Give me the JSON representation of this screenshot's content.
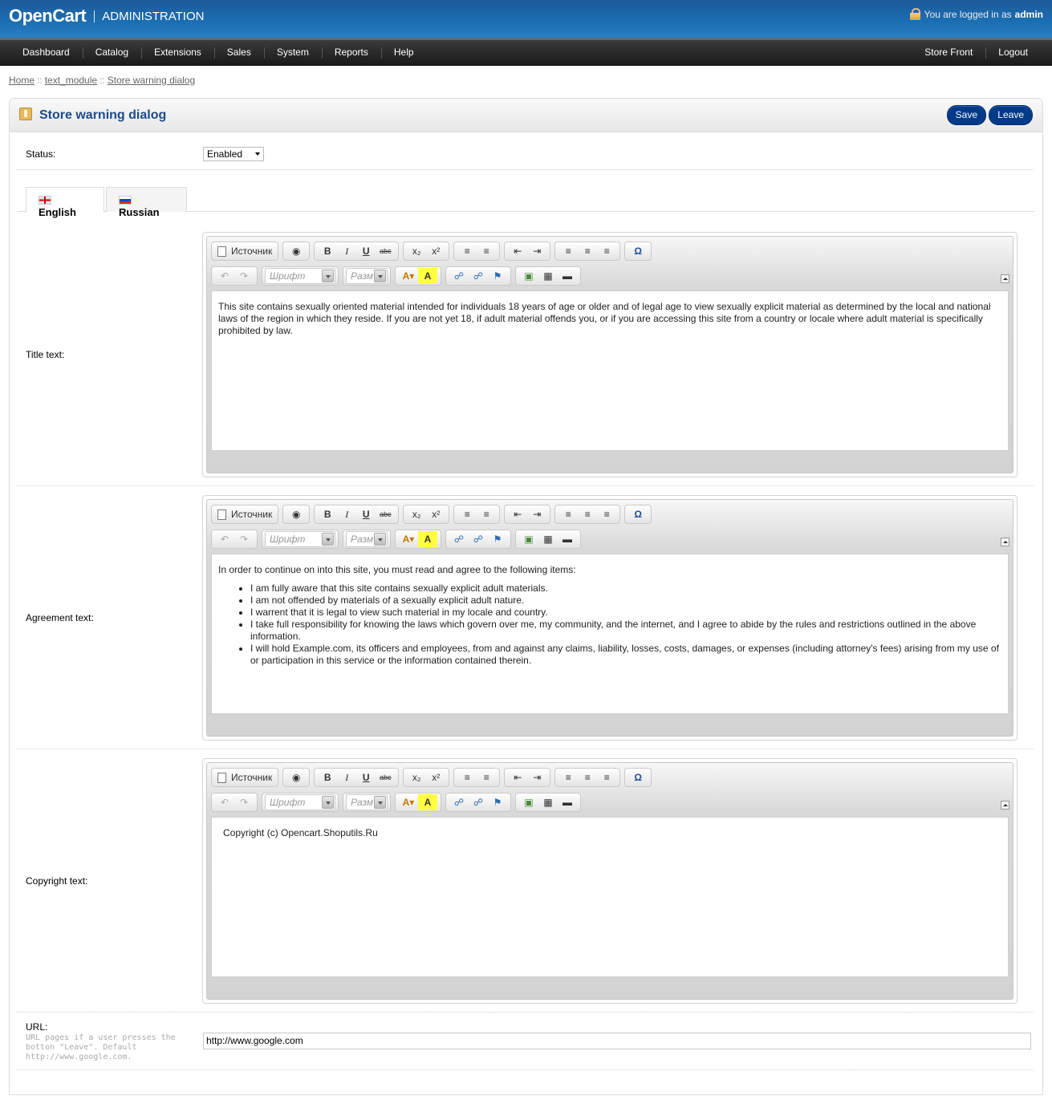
{
  "header": {
    "logo": "OpenCart",
    "admin": "ADMINISTRATION",
    "login_prefix": "You are logged in as",
    "user": "admin"
  },
  "menu": {
    "items": [
      "Dashboard",
      "Catalog",
      "Extensions",
      "Sales",
      "System",
      "Reports",
      "Help"
    ],
    "right": [
      "Store Front",
      "Logout"
    ]
  },
  "breadcrumb": [
    "Home",
    "text_module",
    "Store warning dialog"
  ],
  "box": {
    "title": "Store warning dialog",
    "save": "Save",
    "leave": "Leave"
  },
  "form": {
    "status_label": "Status:",
    "status_value": "Enabled",
    "tabs": [
      "English",
      "Russian"
    ],
    "title_label": "Title text:",
    "agreement_label": "Agreement text:",
    "copyright_label": "Copyright text:",
    "url_label": "URL:",
    "url_help": "URL pages if a user presses the botton \"Leave\". Default http://www.google.com.",
    "url_value": "http://www.google.com"
  },
  "editor": {
    "source": "Источник",
    "font_placeholder": "Шрифт",
    "size_placeholder": "Разм"
  },
  "content": {
    "title_text": "This site contains sexually oriented material intended for individuals 18 years of age or older and of legal age to view sexually explicit material as determined by the local and national laws of the region in which they reside. If you are not yet 18, if adult material offends you, or if you are accessing this site from a country or locale where adult material is specifically prohibited by law.",
    "agreement_intro": "In order to continue on into this site, you must read and agree to the following items:",
    "agreement_items": [
      "I am fully aware that this site contains sexually explicit adult materials.",
      "I am not offended by materials of a sexually explicit adult nature.",
      "I warrent that it is legal to view such material in my locale and country.",
      "I take full responsibility for knowing the laws which govern over me, my community, and the internet, and I agree to abide by the rules and restrictions outlined in the above information.",
      "I will hold Example.com, its officers and employees, from and against any claims, liability, losses, costs, damages, or expenses (including attorney's fees) arising from my use of or participation in this service or the information contained therein."
    ],
    "copyright_text": "Copyright (c) Opencart.Shoputils.Ru"
  },
  "colors": {
    "header_blue": "#1b6fb3",
    "title_blue": "#1d4b8c",
    "button_blue": "#003a88"
  }
}
